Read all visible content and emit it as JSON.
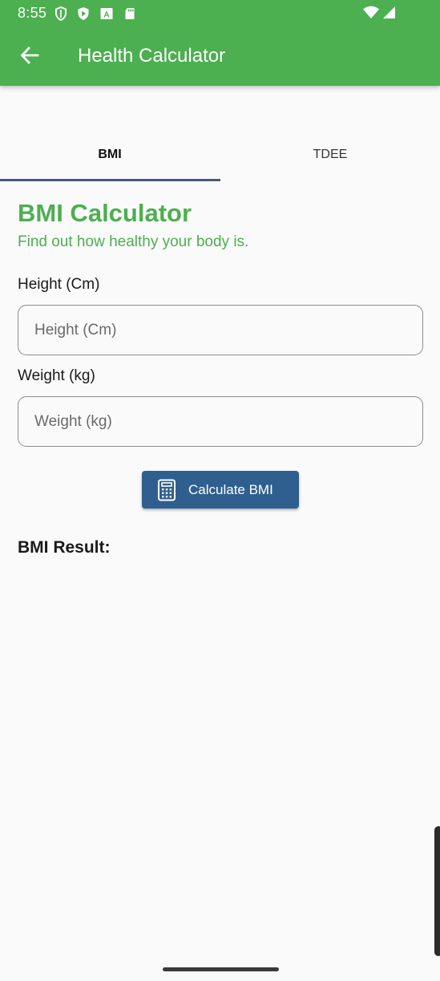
{
  "status_bar": {
    "time": "8:55",
    "icons_left": [
      "shield-icon",
      "play-protect-icon",
      "font-a-icon",
      "sd-card-icon"
    ],
    "icons_right": [
      "wifi-icon",
      "signal-icon"
    ]
  },
  "app_bar": {
    "title": "Health Calculator",
    "back_icon": "arrow-back-icon",
    "background_color": "#4caf50"
  },
  "tabs": [
    {
      "label": "BMI",
      "selected": true
    },
    {
      "label": "TDEE",
      "selected": false
    }
  ],
  "bmi": {
    "heading": "BMI Calculator",
    "subheading": "Find out how healthy your body is.",
    "height_label": "Height (Cm)",
    "height_placeholder": "Height (Cm)",
    "height_value": "",
    "weight_label": "Weight (kg)",
    "weight_placeholder": "Weight (kg)",
    "weight_value": "",
    "calculate_button": "Calculate BMI",
    "calculate_icon": "calculator-icon",
    "result_label": "BMI Result:"
  },
  "colors": {
    "accent_green": "#4caf50",
    "button_blue": "#2f5f8f",
    "tab_indicator": "#4a5a78"
  }
}
